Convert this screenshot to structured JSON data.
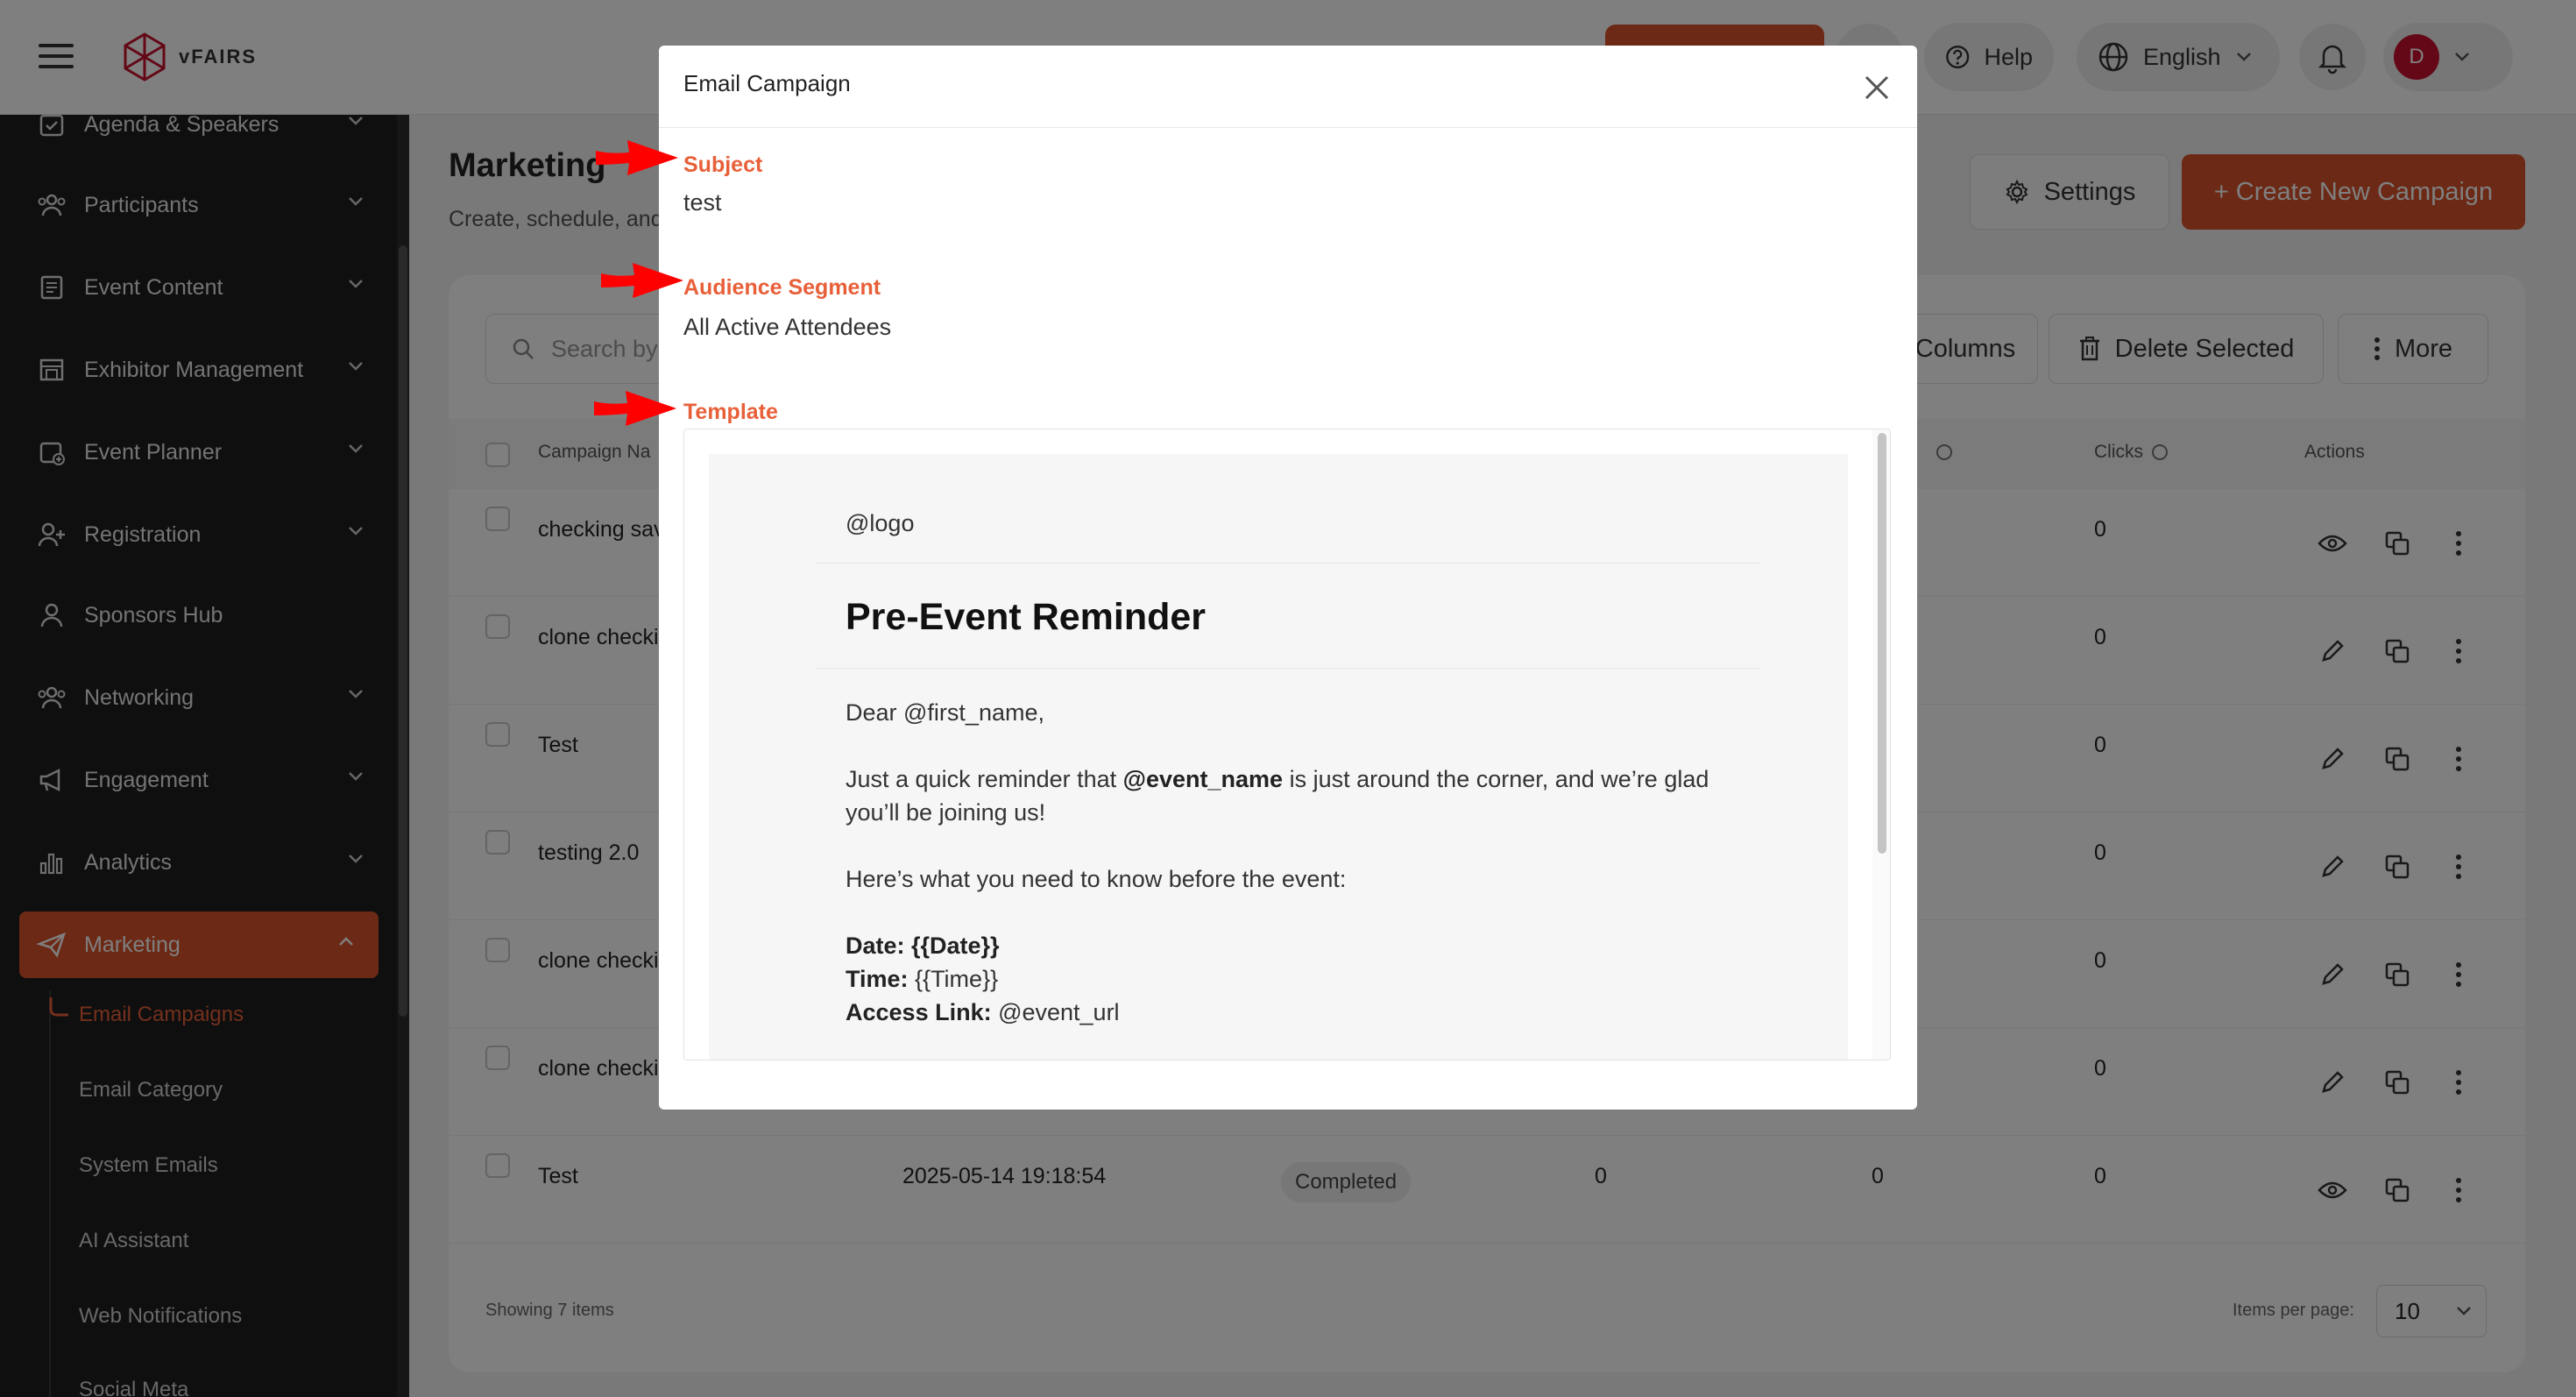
{
  "topbar": {
    "brand": "vFAIRS",
    "help_label": "Help",
    "language_label": "English",
    "avatar_initial": "D"
  },
  "sidebar": {
    "items": [
      {
        "label": "Agenda & Speakers",
        "icon": "calendar-check-icon"
      },
      {
        "label": "Participants",
        "icon": "users-icon"
      },
      {
        "label": "Event Content",
        "icon": "content-icon"
      },
      {
        "label": "Exhibitor Management",
        "icon": "booth-icon"
      },
      {
        "label": "Event Planner",
        "icon": "calendar-plus-icon"
      },
      {
        "label": "Registration",
        "icon": "user-plus-icon"
      },
      {
        "label": "Sponsors Hub",
        "icon": "user-icon"
      },
      {
        "label": "Networking",
        "icon": "network-icon"
      },
      {
        "label": "Engagement",
        "icon": "megaphone-icon"
      },
      {
        "label": "Analytics",
        "icon": "bar-chart-icon"
      },
      {
        "label": "Marketing",
        "icon": "paper-plane-icon"
      }
    ],
    "sub_items": [
      "Email Campaigns",
      "Email Category",
      "System Emails",
      "AI Assistant",
      "Web Notifications",
      "Social Meta"
    ]
  },
  "main": {
    "title": "Marketing",
    "subtitle": "Create, schedule, and",
    "settings_label": "Settings",
    "create_label": "+ Create New Campaign",
    "search_placeholder": "Search by",
    "columns_label": "Columns",
    "delete_label": "Delete Selected",
    "more_label": "More",
    "headers": {
      "campaign_name": "Campaign Na",
      "clicks": "Clicks",
      "actions": "Actions"
    },
    "rows": [
      {
        "name": "checking sav",
        "clicks": "0"
      },
      {
        "name": "clone checki",
        "clicks": "0"
      },
      {
        "name": "Test",
        "clicks": "0"
      },
      {
        "name": "testing 2.0",
        "clicks": "0"
      },
      {
        "name": "clone checki",
        "clicks": "0"
      },
      {
        "name": "clone checki",
        "clicks": "0"
      },
      {
        "name": "Test",
        "date": "2025-05-14 19:18:54",
        "status": "Completed",
        "col_a": "0",
        "col_b": "0",
        "clicks": "0"
      }
    ],
    "showing_label": "Showing 7 items",
    "items_per_page_label": "Items per page:",
    "items_per_page_value": "10"
  },
  "modal": {
    "title": "Email Campaign",
    "subject_label": "Subject",
    "subject_value": "test",
    "audience_label": "Audience Segment",
    "audience_value": "All Active Attendees",
    "template_label": "Template",
    "template": {
      "logo": "@logo",
      "heading": "Pre-Event Reminder",
      "greeting": "Dear @first_name,",
      "p1_a": "Just a quick reminder that ",
      "p1_b": "@event_name",
      "p1_c": " is just around the corner, and we’re glad",
      "p1_d": "you’ll be joining us!",
      "p2": "Here’s what you need to know before the event:",
      "date_label": "Date:",
      "date_value": " {{Date}}",
      "time_label": "Time:",
      "time_value": " {{Time}}",
      "link_label": "Access Link:",
      "link_value": " @event_url"
    }
  },
  "colors": {
    "accent": "#d9532b",
    "label": "#e8603a",
    "arrow": "#ff0000",
    "sidebar": "#1f1f1f"
  }
}
